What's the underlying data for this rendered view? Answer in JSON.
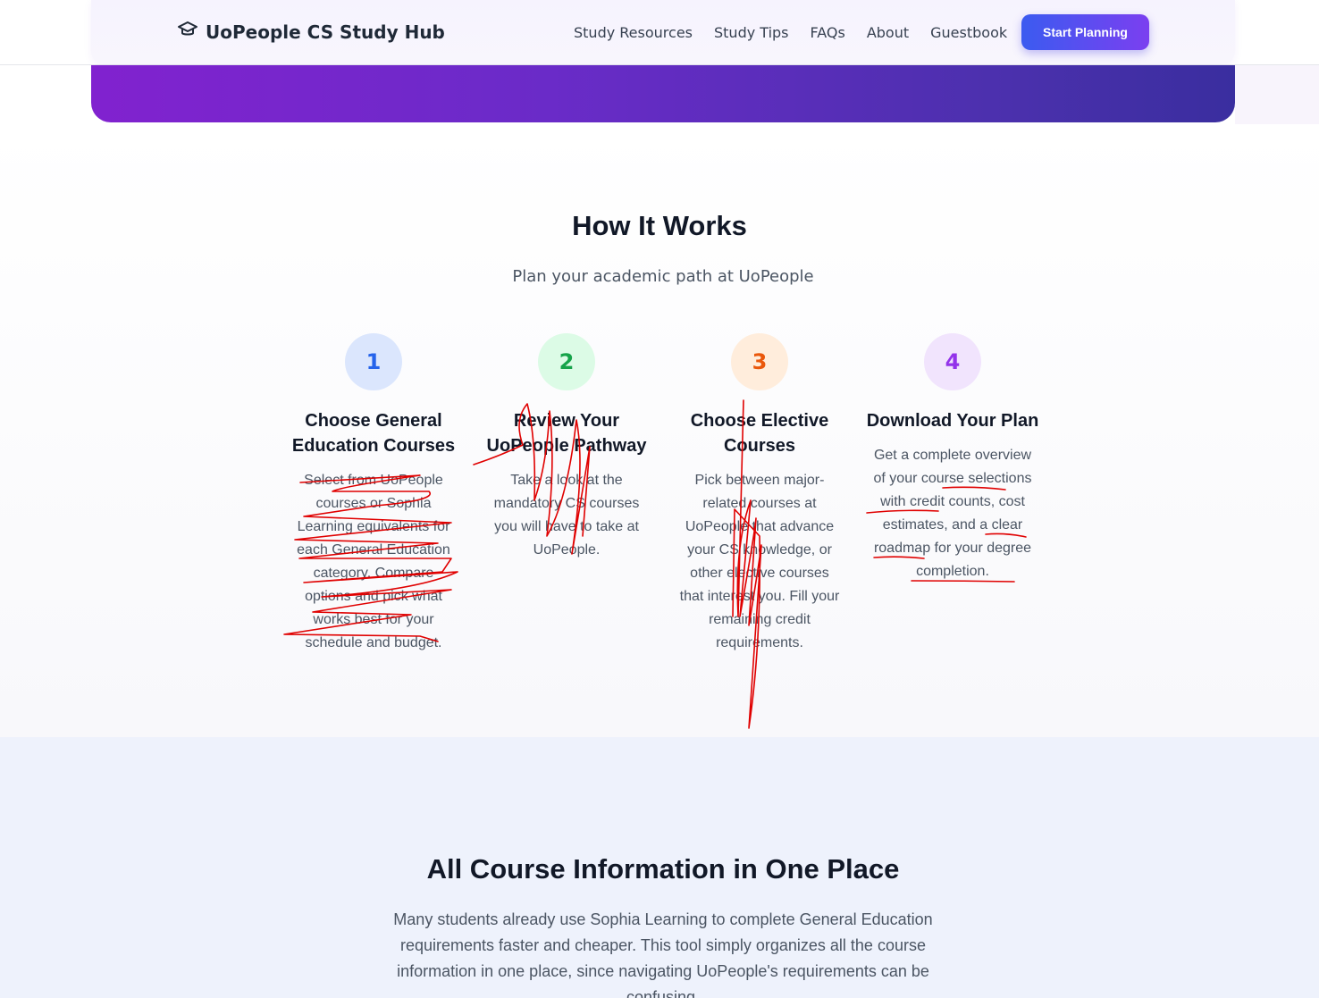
{
  "header": {
    "brand": "UoPeople CS Study Hub",
    "nav": [
      "Study Resources",
      "Study Tips",
      "FAQs",
      "About",
      "Guestbook"
    ],
    "cta": "Start Planning"
  },
  "how_it_works": {
    "title": "How It Works",
    "subtitle": "Plan your academic path at UoPeople",
    "steps": [
      {
        "number": "1",
        "title": "Choose General Education Courses",
        "desc": "Select from UoPeople courses or Sophia Learning equivalents for each General Education category. Compare options and pick what works best for your schedule and budget.",
        "color": "#2563eb",
        "bg": "#dbe6fd"
      },
      {
        "number": "2",
        "title": "Review Your UoPeople Pathway",
        "desc": "Take a look at the mandatory CS courses you will have to take at UoPeople.",
        "color": "#16a34a",
        "bg": "#dcfbe6"
      },
      {
        "number": "3",
        "title": "Choose Elective Courses",
        "desc": "Pick between major-related courses at UoPeople that advance your CS knowledge, or other elective courses that interest you. Fill your remaining credit requirements.",
        "color": "#ea580c",
        "bg": "#ffeddc"
      },
      {
        "number": "4",
        "title": "Download Your Plan",
        "desc": "Get a complete overview of your course selections with credit counts, cost estimates, and a clear roadmap for your degree completion.",
        "color": "#9333ea",
        "bg": "#f1e4fd"
      }
    ]
  },
  "course_info": {
    "title": "All Course Information in One Place",
    "body": "Many students already use Sophia Learning to complete General Education requirements faster and cheaper. This tool simply organizes all the course information in one place, since navigating UoPeople's requirements can be confusing."
  },
  "annotation_color": "#e00000"
}
